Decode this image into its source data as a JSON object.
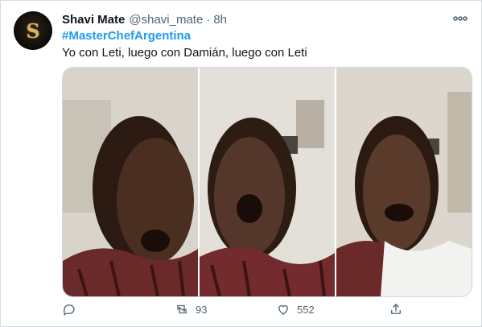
{
  "tweet": {
    "author_name": "Shavi Mate",
    "handle": "@shavi_mate",
    "separator": "·",
    "time": "8h",
    "hashtag": "#MasterChefArgentina",
    "text": "Yo con Leti, luego con Damián, luego con Leti",
    "avatar_letter": "S",
    "more_icon": "more-horizontal-icon"
  },
  "actions": {
    "reply_icon": "reply-icon",
    "retweet_icon": "retweet-icon",
    "retweet_count": "93",
    "like_icon": "heart-icon",
    "like_count": "552",
    "share_icon": "share-icon"
  },
  "colors": {
    "link": "#1d9bf0",
    "secondary_text": "#536471",
    "border": "#cfd9de"
  }
}
